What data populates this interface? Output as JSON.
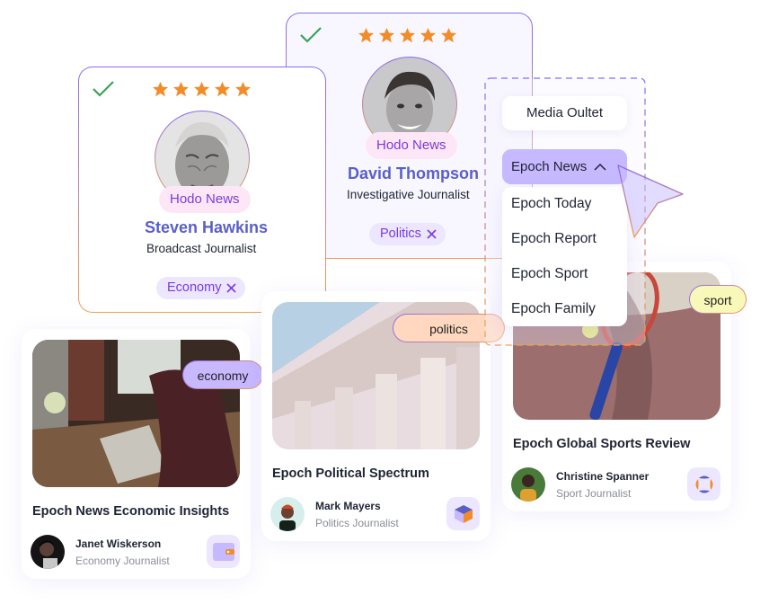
{
  "profiles": [
    {
      "name": "Steven Hawkins",
      "role": "Broadcast Journalist",
      "outlet": "Hodo News",
      "topic": "Economy",
      "rating": 5,
      "rating_max": 5,
      "selected": true
    },
    {
      "name": "David Thompson",
      "role": "Investigative Journalist",
      "outlet": "Hodo News",
      "topic": "Politics",
      "rating": 5,
      "rating_max": 5,
      "selected": true
    }
  ],
  "dropdown": {
    "label": "Media Oultet",
    "selected": "Epoch News",
    "expanded": true,
    "options": [
      "Epoch Today",
      "Epoch Report",
      "Epoch Sport",
      "Epoch Family"
    ]
  },
  "articles": [
    {
      "title": "Epoch News Economic Insights",
      "tag": "economy",
      "author": "Janet Wiskerson",
      "author_role": "Economy Journalist",
      "app_icon": "wallet-icon"
    },
    {
      "title": "Epoch Political Spectrum",
      "tag": "politics",
      "author": "Mark Mayers",
      "author_role": "Politics Journalist",
      "app_icon": "cube-icon"
    },
    {
      "title": "Epoch Global Sports Review",
      "tag": "sport",
      "author": "Christine Spanner",
      "author_role": "Sport Journalist",
      "app_icon": "segments-logo-icon"
    }
  ],
  "colors": {
    "accent_purple": "#8b6cf0",
    "accent_orange": "#f0a050",
    "star": "#f28c28",
    "check": "#3aa357",
    "name": "#5a5fc8",
    "chip_text": "#7b3ae0",
    "dropdown_selected_bg": "#c6b9ff"
  }
}
